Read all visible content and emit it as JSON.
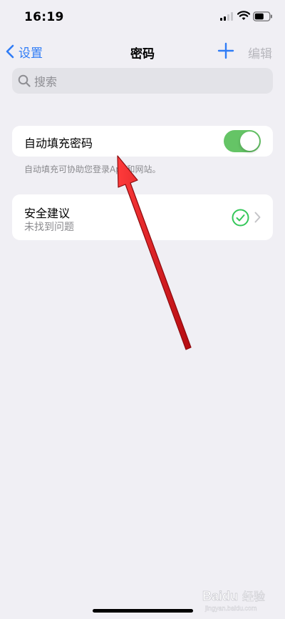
{
  "status_bar": {
    "time": "16:19"
  },
  "nav": {
    "back_label": "设置",
    "title": "密码",
    "edit_label": "编辑"
  },
  "search": {
    "placeholder": "搜索"
  },
  "autofill": {
    "label": "自动填充密码",
    "toggle_on": true,
    "footnote": "自动填充可协助您登录App和网站。"
  },
  "security": {
    "title": "安全建议",
    "subtitle": "未找到问题"
  },
  "watermark": {
    "text": "Baidu经验",
    "url": "jingyan.baidu.com"
  },
  "colors": {
    "accent": "#2f7cf6",
    "toggle_on": "#65c466",
    "annotation_arrow": "#e3141b"
  }
}
